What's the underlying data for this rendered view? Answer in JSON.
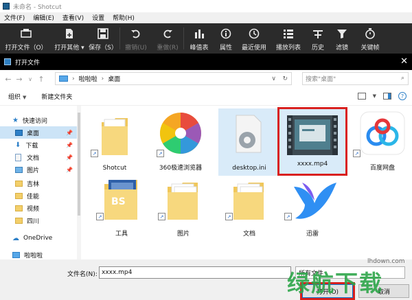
{
  "app": {
    "title": "未命名 - Shotcut",
    "menu": [
      "文件(F)",
      "编辑(E)",
      "查看(V)",
      "设置",
      "帮助(H)"
    ]
  },
  "toolbar": [
    {
      "label": "打开文件（O）",
      "icon": "open-file-icon",
      "dim": false
    },
    {
      "label": "打开其他 ▾",
      "icon": "open-other-icon",
      "dim": false
    },
    {
      "label": "保存（S）",
      "icon": "save-icon",
      "dim": false
    },
    {
      "label": "撤销(U)",
      "icon": "undo-icon",
      "dim": true
    },
    {
      "label": "重做(R)",
      "icon": "redo-icon",
      "dim": true
    },
    {
      "label": "峰值表",
      "icon": "peak-meter-icon",
      "dim": false
    },
    {
      "label": "属性",
      "icon": "properties-icon",
      "dim": false
    },
    {
      "label": "最近使用",
      "icon": "recent-icon",
      "dim": false
    },
    {
      "label": "播放列表",
      "icon": "playlist-icon",
      "dim": false
    },
    {
      "label": "历史",
      "icon": "history-icon",
      "dim": false
    },
    {
      "label": "滤镜",
      "icon": "filter-icon",
      "dim": false
    },
    {
      "label": "关键帧",
      "icon": "keyframe-icon",
      "dim": false
    }
  ],
  "dialog": {
    "title": "打开文件",
    "breadcrumb": [
      "啦啦啦",
      "桌面"
    ],
    "search_placeholder": "搜索\"桌面\"",
    "organize": "组织",
    "new_folder": "新建文件夹"
  },
  "nav": [
    {
      "label": "快速访问",
      "icon": "star-icon",
      "pinned": false,
      "selected": false
    },
    {
      "label": "桌面",
      "icon": "desktop-icon",
      "pinned": true,
      "selected": true
    },
    {
      "label": "下载",
      "icon": "download-icon",
      "pinned": true,
      "selected": false
    },
    {
      "label": "文档",
      "icon": "document-icon",
      "pinned": true,
      "selected": false
    },
    {
      "label": "图片",
      "icon": "picture-icon",
      "pinned": true,
      "selected": false
    },
    {
      "label": "吉林",
      "icon": "folder-icon",
      "pinned": false,
      "selected": false
    },
    {
      "label": "佳能",
      "icon": "folder-icon",
      "pinned": false,
      "selected": false
    },
    {
      "label": "视频",
      "icon": "folder-icon",
      "pinned": false,
      "selected": false
    },
    {
      "label": "四川",
      "icon": "folder-icon",
      "pinned": false,
      "selected": false
    },
    {
      "label": "OneDrive",
      "icon": "onedrive-icon",
      "pinned": false,
      "selected": false
    },
    {
      "label": "啦啦啦",
      "icon": "computer-icon",
      "pinned": false,
      "selected": false
    }
  ],
  "files": [
    {
      "label": "Shotcut",
      "icon": "folder-icon",
      "shortcut": true
    },
    {
      "label": "360极速浏览器",
      "icon": "browser-360-icon",
      "shortcut": true
    },
    {
      "label": "desktop.ini",
      "icon": "settings-file-icon",
      "shortcut": false
    },
    {
      "label": "xxxx.mp4",
      "icon": "video-file-icon",
      "shortcut": false
    },
    {
      "label": "百度网盘",
      "icon": "baidu-netdisk-icon",
      "shortcut": true
    },
    {
      "label": "工具",
      "icon": "folder-icon",
      "shortcut": true
    },
    {
      "label": "图片",
      "icon": "folder-icon",
      "shortcut": true
    },
    {
      "label": "文档",
      "icon": "folder-icon",
      "shortcut": true
    },
    {
      "label": "迅雷",
      "icon": "xunlei-icon",
      "shortcut": true
    }
  ],
  "bottom": {
    "filename_label": "文件名(N):",
    "filename_value": "xxxx.mp4",
    "filetype": "所有文件",
    "open": "打开(O)",
    "cancel": "取消"
  },
  "watermark": {
    "big": "绿航下载",
    "small": "lhdown.com"
  }
}
